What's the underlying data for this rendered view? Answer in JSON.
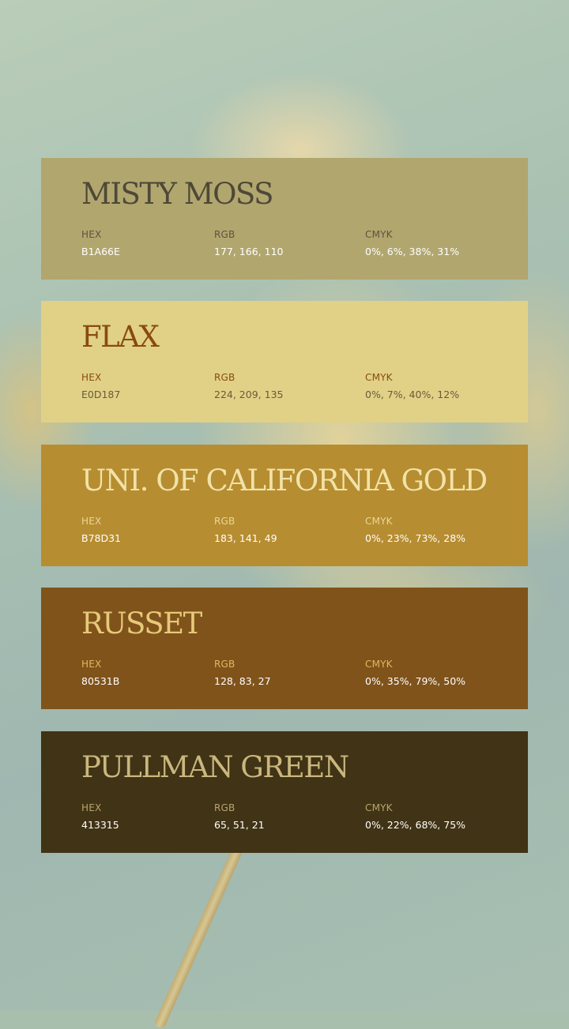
{
  "palette": [
    {
      "name": "MISTY MOSS",
      "hex_label": "HEX",
      "hex": "B1A66E",
      "rgb_label": "RGB",
      "rgb": "177, 166, 110",
      "cmyk_label": "CMYK",
      "cmyk": "0%, 6%, 38%, 31%",
      "colors": {
        "background": "#B1A66E",
        "title": "#4E4837",
        "label": "#5B543F",
        "value": "#FFFFFF"
      }
    },
    {
      "name": "FLAX",
      "hex_label": "HEX",
      "hex": "E0D187",
      "rgb_label": "RGB",
      "rgb": "224, 209, 135",
      "cmyk_label": "CMYK",
      "cmyk": "0%, 7%, 40%, 12%",
      "colors": {
        "background": "#E0D187",
        "title": "#8A4A10",
        "label": "#8A4A10",
        "value": "#6B5A3A"
      }
    },
    {
      "name": "UNI. OF CALIFORNIA GOLD",
      "hex_label": "HEX",
      "hex": "B78D31",
      "rgb_label": "RGB",
      "rgb": "183, 141, 49",
      "cmyk_label": "CMYK",
      "cmyk": "0%, 23%, 73%, 28%",
      "colors": {
        "background": "#B78D31",
        "title": "#F1E3A8",
        "label": "#E8D79A",
        "value": "#FFFFFF"
      }
    },
    {
      "name": "RUSSET",
      "hex_label": "HEX",
      "hex": "80531B",
      "rgb_label": "RGB",
      "rgb": "128, 83, 27",
      "cmyk_label": "CMYK",
      "cmyk": "0%, 35%, 79%, 50%",
      "colors": {
        "background": "#80531B",
        "title": "#E6C97A",
        "label": "#E0B860",
        "value": "#FFFFFF"
      }
    },
    {
      "name": "PULLMAN GREEN",
      "hex_label": "HEX",
      "hex": "413315",
      "rgb_label": "RGB",
      "rgb": "65, 51, 21",
      "cmyk_label": "CMYK",
      "cmyk": "0%, 22%, 68%, 75%",
      "colors": {
        "background": "#413315",
        "title": "#C9B77E",
        "label": "#B8A56E",
        "value": "#FFFFFF"
      }
    }
  ]
}
